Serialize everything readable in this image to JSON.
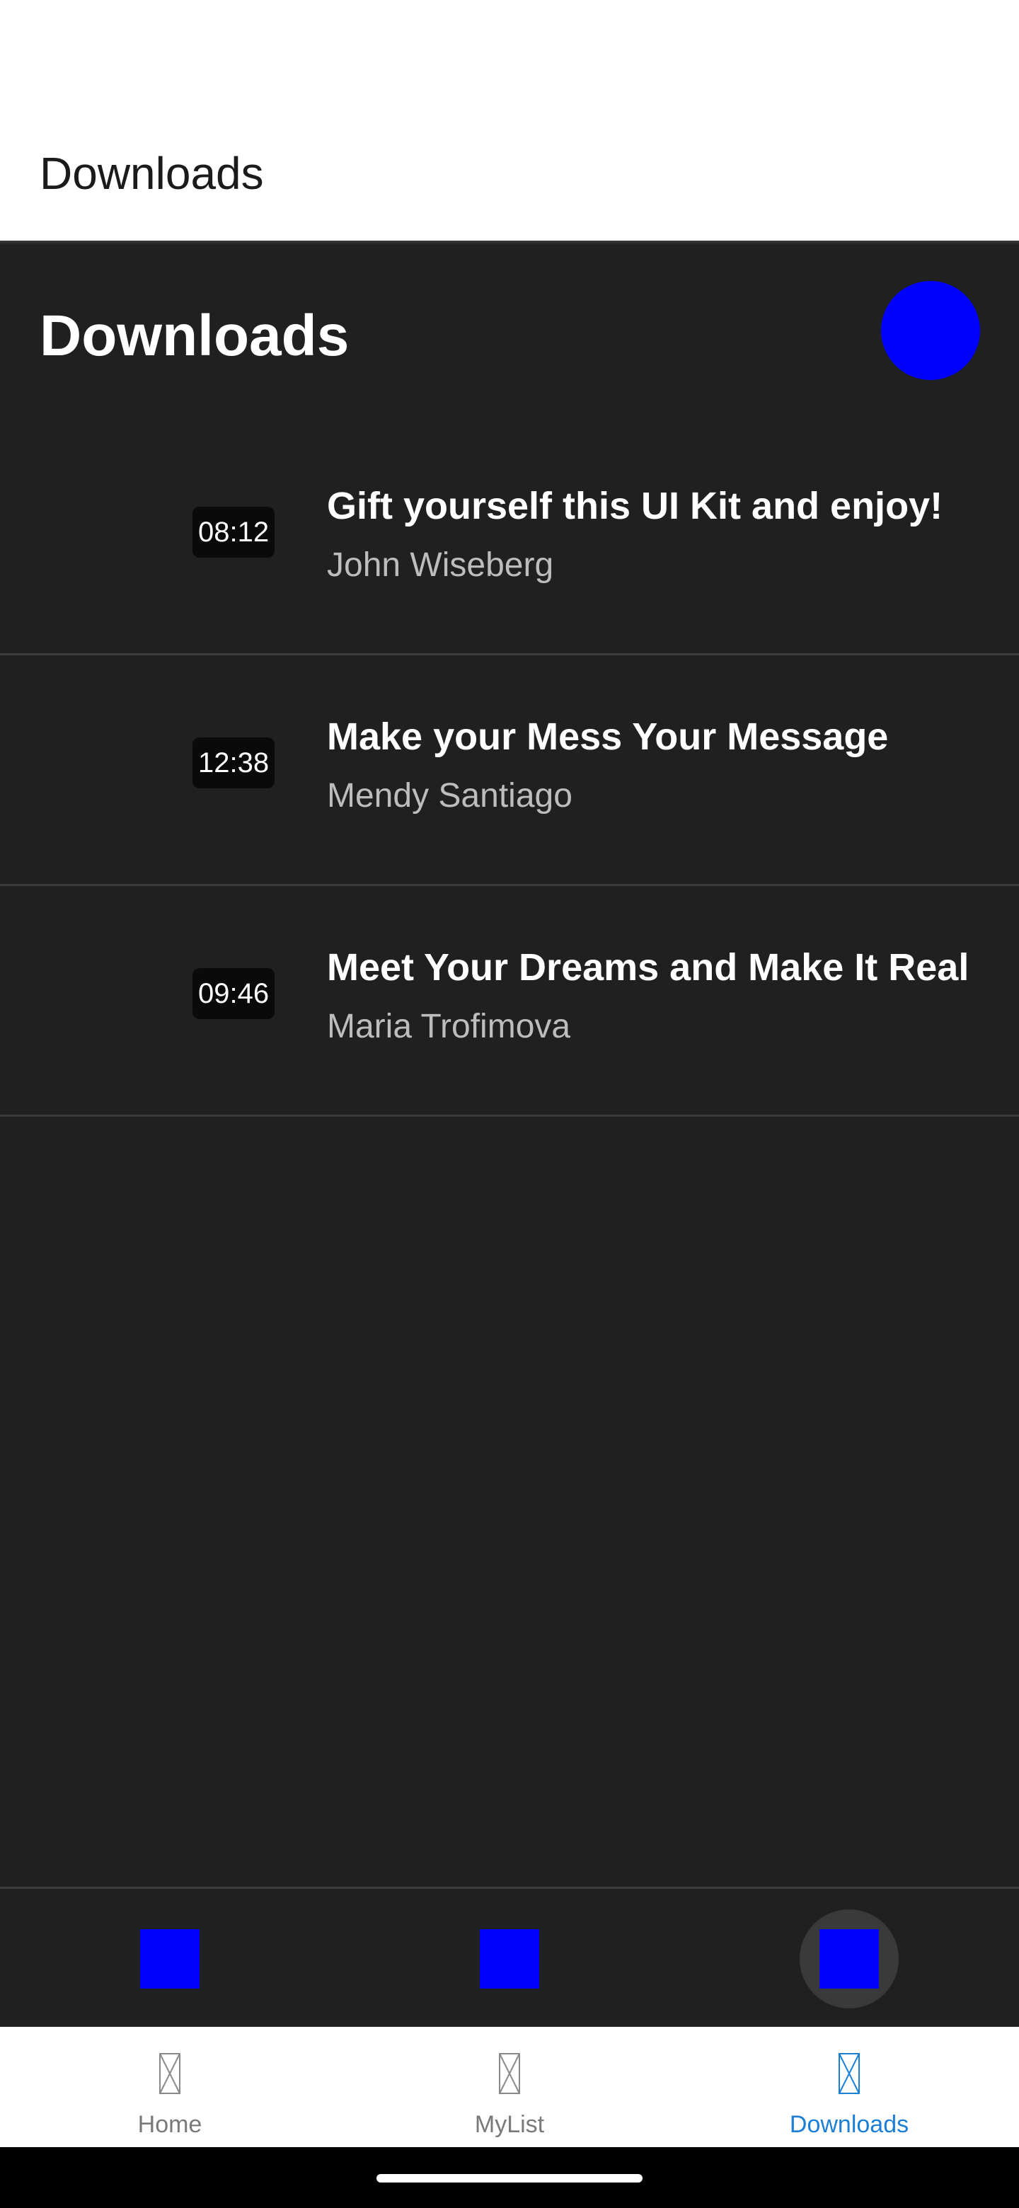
{
  "app_bar": {
    "title": "Downloads"
  },
  "section": {
    "title": "Downloads"
  },
  "downloads": [
    {
      "title": "Gift yourself this UI Kit and enjoy!",
      "author": "John Wiseberg",
      "duration": "08:12"
    },
    {
      "title": "Make your Mess Your Message",
      "author": "Mendy Santiago",
      "duration": "12:38"
    },
    {
      "title": "Meet Your Dreams and Make It Real",
      "author": "Maria Trofimova",
      "duration": "09:46"
    }
  ],
  "bottom_nav": {
    "items": [
      {
        "label": "Home",
        "icon": "placeholder-icon",
        "active": false
      },
      {
        "label": "MyList",
        "icon": "placeholder-icon",
        "active": false
      },
      {
        "label": "Downloads",
        "icon": "placeholder-icon",
        "active": true
      }
    ]
  },
  "colors": {
    "accent_placeholder": "#0000ff",
    "active_nav": "#1b7fd6",
    "background_dark": "#202020",
    "divider": "#3b3b3b"
  }
}
